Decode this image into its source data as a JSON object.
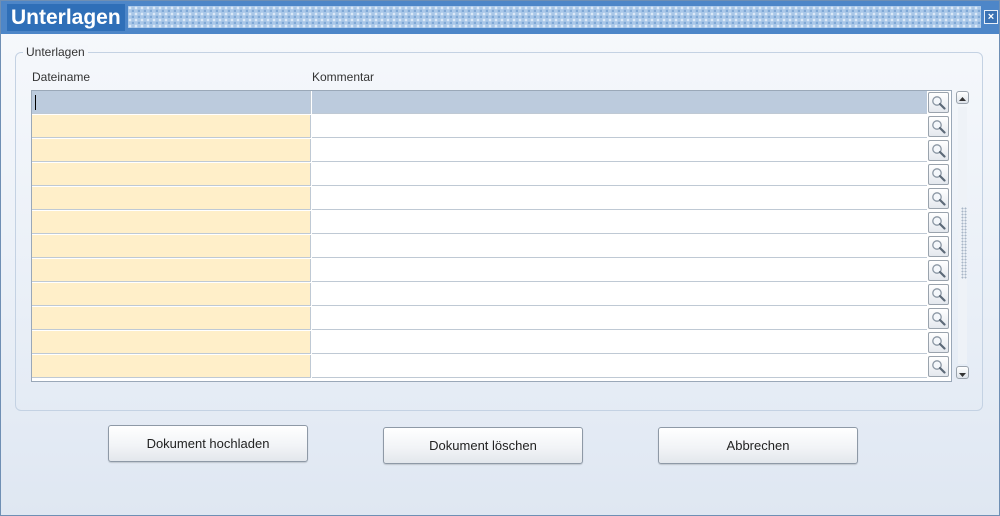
{
  "window": {
    "title": "Unterlagen",
    "close_icon": "close-icon",
    "close_glyph": "×"
  },
  "group": {
    "legend": "Unterlagen"
  },
  "table": {
    "columns": [
      "Dateiname",
      "Kommentar"
    ],
    "row_count": 12,
    "selected_row": 0,
    "lov_icon": "magnifier-icon",
    "rows": [
      {
        "dateiname": "",
        "kommentar": ""
      },
      {
        "dateiname": "",
        "kommentar": ""
      },
      {
        "dateiname": "",
        "kommentar": ""
      },
      {
        "dateiname": "",
        "kommentar": ""
      },
      {
        "dateiname": "",
        "kommentar": ""
      },
      {
        "dateiname": "",
        "kommentar": ""
      },
      {
        "dateiname": "",
        "kommentar": ""
      },
      {
        "dateiname": "",
        "kommentar": ""
      },
      {
        "dateiname": "",
        "kommentar": ""
      },
      {
        "dateiname": "",
        "kommentar": ""
      },
      {
        "dateiname": "",
        "kommentar": ""
      },
      {
        "dateiname": "",
        "kommentar": ""
      }
    ]
  },
  "buttons": {
    "upload": "Dokument hochladen",
    "delete": "Dokument löschen",
    "cancel": "Abbrechen"
  },
  "colors": {
    "title_bar": "#4d86c8",
    "name_cell": "#ffefc9",
    "selected_row": "#bccbdd"
  }
}
